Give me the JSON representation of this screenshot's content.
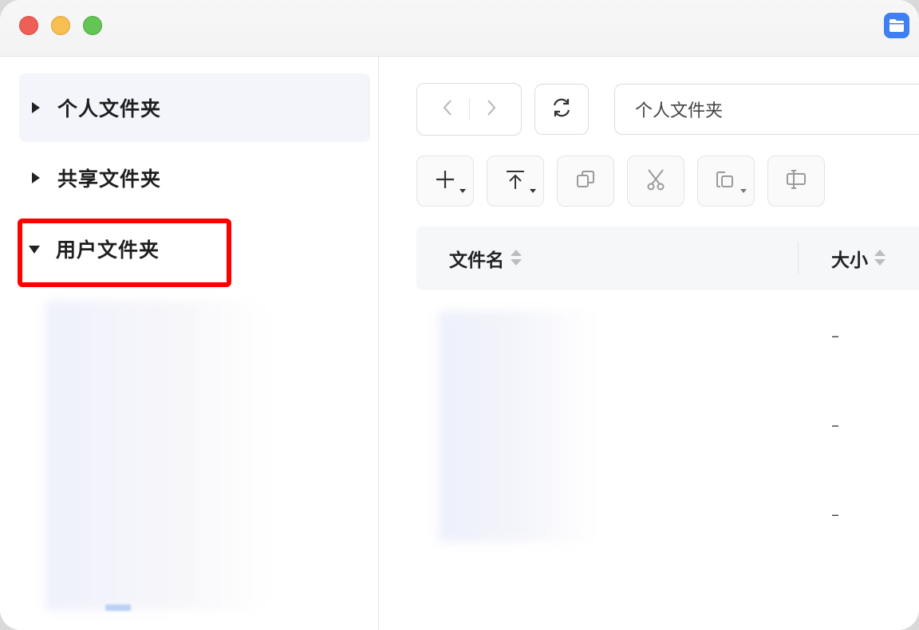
{
  "sidebar": {
    "items": [
      {
        "label": "个人文件夹",
        "expanded": false,
        "selected": true
      },
      {
        "label": "共享文件夹",
        "expanded": false,
        "selected": false
      },
      {
        "label": "用户文件夹",
        "expanded": true,
        "selected": false
      }
    ]
  },
  "toolbar": {
    "path": "个人文件夹"
  },
  "table": {
    "columns": [
      "文件名",
      "大小"
    ],
    "rows": [
      {
        "size": "–"
      },
      {
        "size": "–"
      },
      {
        "size": "–"
      }
    ]
  },
  "colors": {
    "accent": "#3f7ff2",
    "highlight": "#ff0000"
  }
}
